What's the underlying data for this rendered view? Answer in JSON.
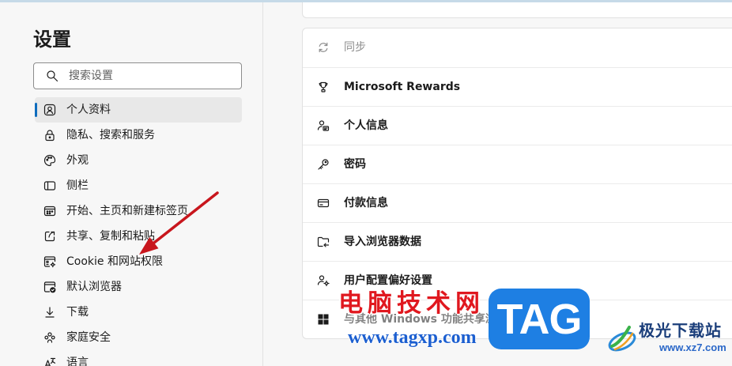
{
  "page": {
    "accent_color": "#0f6cbd",
    "top_strip_color": "#c6dae8"
  },
  "sidebar": {
    "title": "设置",
    "search": {
      "placeholder": "搜索设置",
      "value": "",
      "icon": "search-icon"
    },
    "items": [
      {
        "label": "个人资料",
        "icon": "profile-icon",
        "selected": true
      },
      {
        "label": "隐私、搜索和服务",
        "icon": "lock-icon",
        "selected": false
      },
      {
        "label": "外观",
        "icon": "palette-icon",
        "selected": false
      },
      {
        "label": "侧栏",
        "icon": "sidebar-panel-icon",
        "selected": false
      },
      {
        "label": "开始、主页和新建标签页",
        "icon": "start-page-icon",
        "selected": false
      },
      {
        "label": "共享、复制和粘贴",
        "icon": "share-icon",
        "selected": false
      },
      {
        "label": "Cookie 和网站权限",
        "icon": "site-permissions-icon",
        "selected": false
      },
      {
        "label": "默认浏览器",
        "icon": "default-browser-icon",
        "selected": false
      },
      {
        "label": "下载",
        "icon": "download-icon",
        "selected": false
      },
      {
        "label": "家庭安全",
        "icon": "family-icon",
        "selected": false
      },
      {
        "label": "语言",
        "icon": "language-icon",
        "selected": false
      }
    ]
  },
  "main": {
    "profile_settings": [
      {
        "label": "同步",
        "icon": "sync-icon",
        "disabled": true
      },
      {
        "label": "Microsoft Rewards",
        "icon": "trophy-icon",
        "disabled": false
      },
      {
        "label": "个人信息",
        "icon": "personal-info-icon",
        "disabled": false
      },
      {
        "label": "密码",
        "icon": "key-icon",
        "disabled": false
      },
      {
        "label": "付款信息",
        "icon": "payment-card-icon",
        "disabled": false
      },
      {
        "label": "导入浏览器数据",
        "icon": "import-folder-icon",
        "disabled": false
      },
      {
        "label": "用户配置偏好设置",
        "icon": "profile-preferences-icon",
        "disabled": false
      },
      {
        "label": "与其他 Windows 功能共享浏览数据",
        "icon": "windows-icon",
        "disabled": false
      }
    ]
  },
  "watermarks": {
    "site_name": "电脑技术网",
    "tag_logo": "TAG",
    "site_url": "www.tagxp.com",
    "download_site_name": "极光下载站",
    "download_site_url": "www.xz7.com",
    "site_name_color": "#e0181f",
    "tag_color": "#1e7fe3",
    "arrow_color": "#c8161d"
  }
}
